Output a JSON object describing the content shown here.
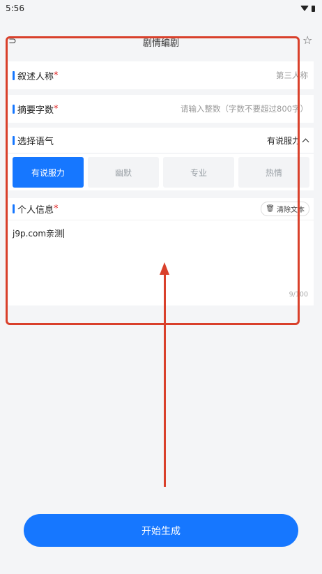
{
  "status_bar": {
    "time": "5:56"
  },
  "header": {
    "title": "剧情编剧"
  },
  "narration": {
    "label": "叙述人称",
    "required_mark": "*",
    "value": "第三人称"
  },
  "summary": {
    "label": "摘要字数",
    "required_mark": "*",
    "placeholder": "请输入整数（字数不要超过800字）"
  },
  "tone": {
    "label": "选择语气",
    "selected": "有说服力",
    "options": [
      "有说服力",
      "幽默",
      "专业",
      "热情"
    ]
  },
  "personal_info": {
    "label": "个人信息",
    "required_mark": "*",
    "clear_label": "清除文本",
    "text": "j9p.com亲测",
    "counter": "9/100"
  },
  "generate_button": {
    "label": "开始生成"
  },
  "colors": {
    "accent": "#1677ff",
    "required": "#e02424",
    "annotation": "#d9402b"
  }
}
